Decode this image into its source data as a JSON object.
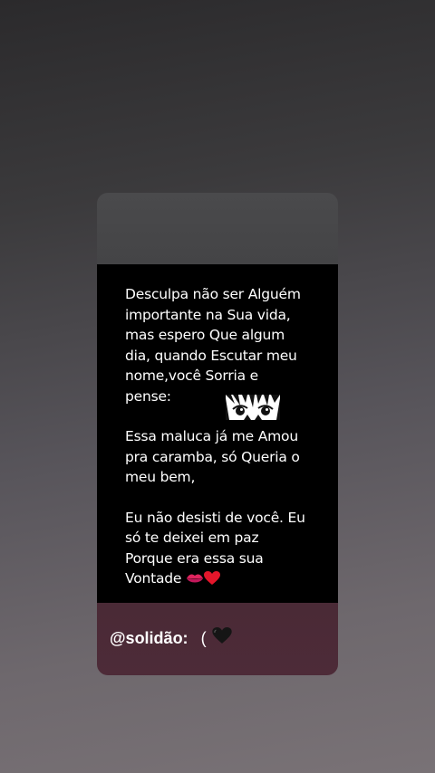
{
  "post": {
    "paragraph1": "Desculpa não ser Alguém\nimportante na Sua vida,\nmas espero Que algum\ndia, quando Escutar meu\nnome,você Sorria e\npense:",
    "paragraph2": "Essa maluca já me Amou\npra caramba, só Queria o\nmeu bem,",
    "paragraph3": "Eu não desisti de você. Eu\nsó te deixei em paz\nPorque era essa sua\nVontade",
    "icons": [
      "anime-eyes-sticker",
      "kiss-lips-emoji",
      "red-heart-emoji"
    ]
  },
  "footer": {
    "username": "@solidão:",
    "suffix_text": "(",
    "icons": [
      "black-heart-emoji"
    ]
  },
  "colors": {
    "card_body": "#000000",
    "card_top": "#4a4a4c",
    "card_footer": "#4a2a36",
    "text": "#ffffff"
  }
}
